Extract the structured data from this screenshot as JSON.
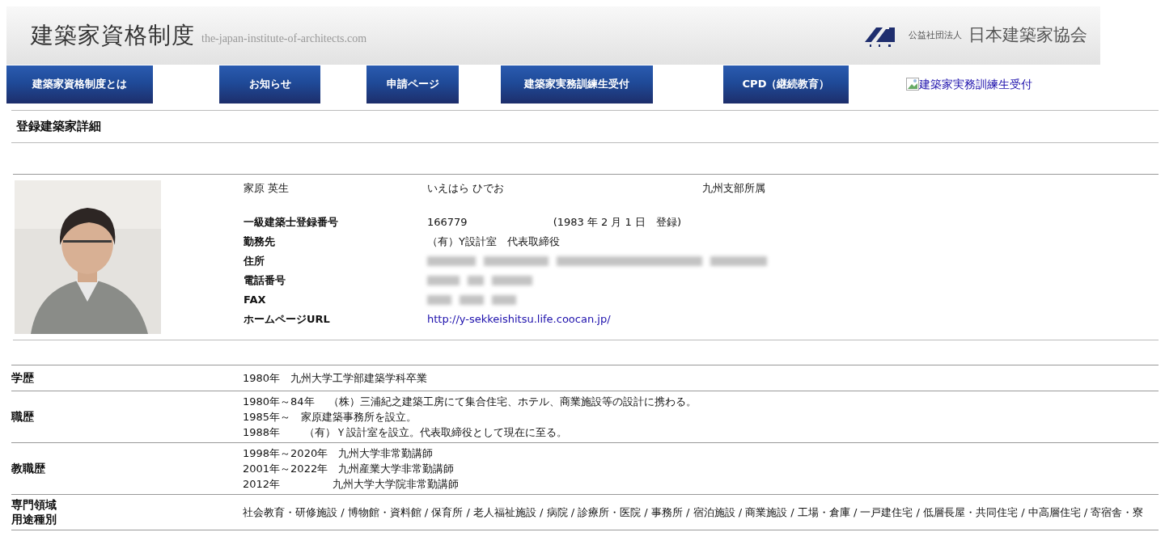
{
  "header": {
    "title": "建築家資格制度",
    "domain": "the-japan-institute-of-architects.com",
    "org_prefix": "公益社団法人",
    "org_name": "日本建築家協会"
  },
  "nav": [
    {
      "label": "建築家資格制度とは",
      "kind": "button"
    },
    {
      "label": "お知らせ",
      "kind": "button"
    },
    {
      "label": "申請ページ",
      "kind": "button"
    },
    {
      "label": "建築家実務訓練生受付",
      "kind": "button"
    },
    {
      "label": "CPD（継続教育）",
      "kind": "button"
    },
    {
      "label": "建築家実務訓練生受付",
      "kind": "broken-image-link"
    }
  ],
  "section_title": "登録建築家詳細",
  "profile": {
    "name": "家原 英生",
    "kana": "いえはら ひでお",
    "branch": "九州支部所属",
    "fields": [
      {
        "label": "一級建築士登録番号",
        "kind": "text",
        "value": "166779",
        "note": "(1983 年 2 月 1 日　登録)"
      },
      {
        "label": "勤務先",
        "kind": "text",
        "value": "（有）Y設計室　代表取締役"
      },
      {
        "label": "住所",
        "kind": "redacted"
      },
      {
        "label": "電話番号",
        "kind": "redacted"
      },
      {
        "label": "FAX",
        "kind": "redacted"
      },
      {
        "label": "ホームページURL",
        "kind": "link",
        "value": "http://y-sekkeishitsu.life.coocan.jp/"
      }
    ]
  },
  "history": [
    {
      "label": "学歴",
      "lines": [
        "1980年　九州大学工学部建築学科卒業"
      ]
    },
    {
      "label": "職歴",
      "lines": [
        "1980年～84年　 （株）三浦紀之建築工房にて集合住宅、ホテル、商業施設等の設計に携わる。",
        "1985年～　家原建築事務所を設立。",
        "1988年　　 （有）Ｙ設計室を設立。代表取締役として現在に至る。"
      ]
    },
    {
      "label": "教職歴",
      "lines": [
        "1998年～2020年　九州大学非常勤講師",
        "2001年～2022年　九州産業大学非常勤講師",
        "2012年　　　　　九州大学大学院非常勤講師"
      ]
    },
    {
      "label_lines": [
        "専門領域",
        "用途種別"
      ],
      "lines": [
        "社会教育・研修施設 / 博物館・資料館 / 保育所 / 老人福祉施設 / 病院 / 診療所・医院 / 事務所 / 宿泊施設 / 商業施設 / 工場・倉庫 / 一戸建住宅 / 低層長屋・共同住宅 / 中高層住宅 / 寄宿舎・寮"
      ]
    }
  ]
}
